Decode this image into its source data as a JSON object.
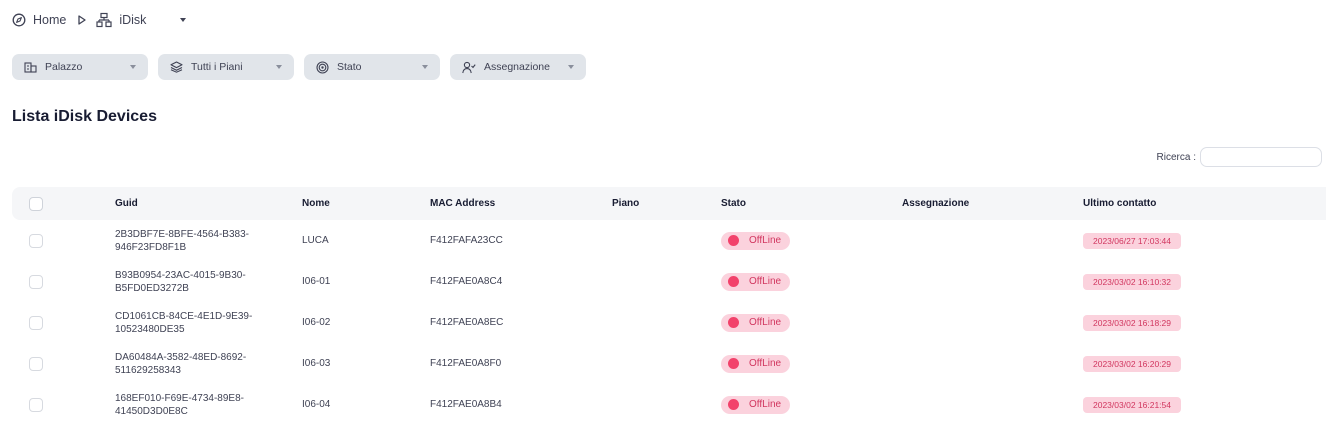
{
  "breadcrumb": {
    "home_label": "Home",
    "current_label": "iDisk"
  },
  "filters": [
    {
      "label": "Palazzo",
      "icon": "building-icon"
    },
    {
      "label": "Tutti i Piani",
      "icon": "layers-icon"
    },
    {
      "label": "Stato",
      "icon": "target-icon"
    },
    {
      "label": "Assegnazione",
      "icon": "user-assign-icon"
    }
  ],
  "page_title": "Lista iDisk Devices",
  "search": {
    "label": "Ricerca :",
    "value": "",
    "placeholder": ""
  },
  "table": {
    "columns": [
      "Guid",
      "Nome",
      "MAC Address",
      "Piano",
      "Stato",
      "Assegnazione",
      "Ultimo contatto"
    ],
    "rows": [
      {
        "guid_1": "2B3DBF7E-8BFE-4564-B383-",
        "guid_2": "946F23FD8F1B",
        "nome": "LUCA",
        "mac": "F412FAFA23CC",
        "piano": "",
        "stato": "OffLine",
        "assegnazione": "",
        "ultimo_contatto": "2023/06/27 17:03:44"
      },
      {
        "guid_1": "B93B0954-23AC-4015-9B30-",
        "guid_2": "B5FD0ED3272B",
        "nome": "I06-01",
        "mac": "F412FAE0A8C4",
        "piano": "",
        "stato": "OffLine",
        "assegnazione": "",
        "ultimo_contatto": "2023/03/02 16:10:32"
      },
      {
        "guid_1": "CD1061CB-84CE-4E1D-9E39-",
        "guid_2": "10523480DE35",
        "nome": "I06-02",
        "mac": "F412FAE0A8EC",
        "piano": "",
        "stato": "OffLine",
        "assegnazione": "",
        "ultimo_contatto": "2023/03/02 16:18:29"
      },
      {
        "guid_1": "DA60484A-3582-48ED-8692-",
        "guid_2": "511629258343",
        "nome": "I06-03",
        "mac": "F412FAE0A8F0",
        "piano": "",
        "stato": "OffLine",
        "assegnazione": "",
        "ultimo_contatto": "2023/03/02 16:20:29"
      },
      {
        "guid_1": "168EF010-F69E-4734-89E8-",
        "guid_2": "41450D3D0E8C",
        "nome": "I06-04",
        "mac": "F412FAE0A8B4",
        "piano": "",
        "stato": "OffLine",
        "assegnazione": "",
        "ultimo_contatto": "2023/03/02 16:21:54"
      }
    ]
  },
  "colors": {
    "filter_bg": "#e1e5ea",
    "header_bg": "#f5f6f8",
    "status_badge_bg": "#fbd2dd",
    "status_dot": "#f2426b",
    "status_text": "#d1365f"
  }
}
